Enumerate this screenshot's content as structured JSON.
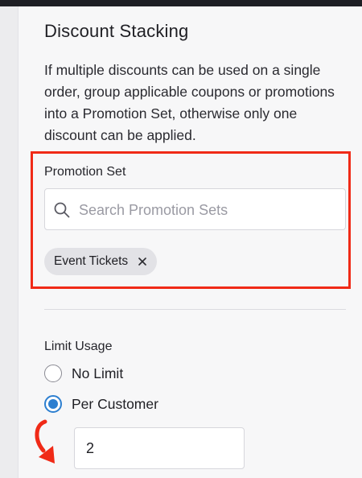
{
  "section": {
    "title": "Discount Stacking",
    "description": "If multiple discounts can be used on a single order, group applicable coupons or promotions into a Promotion Set, otherwise only one discount can be applied."
  },
  "promotion_set": {
    "label": "Promotion Set",
    "search_placeholder": "Search Promotion Sets",
    "selected": [
      {
        "label": "Event Tickets"
      }
    ]
  },
  "limit_usage": {
    "label": "Limit Usage",
    "options": [
      {
        "label": "No Limit",
        "selected": false
      },
      {
        "label": "Per Customer",
        "selected": true
      }
    ],
    "per_customer_value": "2"
  },
  "annotations": {
    "highlight_color": "#f02a17",
    "arrow_color": "#f02a17"
  },
  "colors": {
    "accent": "#2d7fd0"
  }
}
